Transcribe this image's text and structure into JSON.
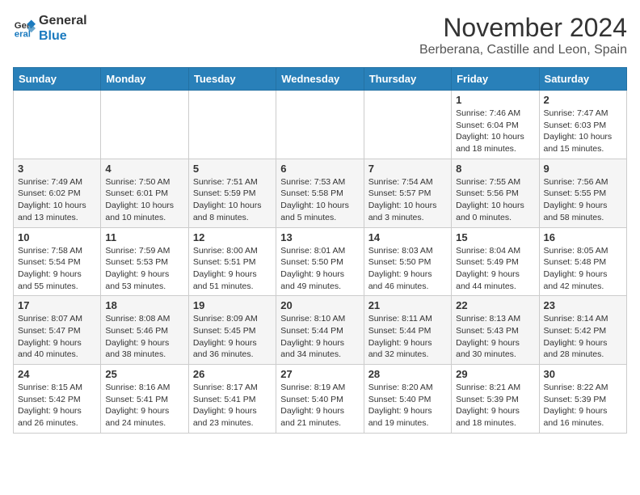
{
  "logo": {
    "line1": "General",
    "line2": "Blue"
  },
  "title": "November 2024",
  "location": "Berberana, Castille and Leon, Spain",
  "days_of_week": [
    "Sunday",
    "Monday",
    "Tuesday",
    "Wednesday",
    "Thursday",
    "Friday",
    "Saturday"
  ],
  "weeks": [
    [
      {
        "day": "",
        "info": ""
      },
      {
        "day": "",
        "info": ""
      },
      {
        "day": "",
        "info": ""
      },
      {
        "day": "",
        "info": ""
      },
      {
        "day": "",
        "info": ""
      },
      {
        "day": "1",
        "info": "Sunrise: 7:46 AM\nSunset: 6:04 PM\nDaylight: 10 hours and 18 minutes."
      },
      {
        "day": "2",
        "info": "Sunrise: 7:47 AM\nSunset: 6:03 PM\nDaylight: 10 hours and 15 minutes."
      }
    ],
    [
      {
        "day": "3",
        "info": "Sunrise: 7:49 AM\nSunset: 6:02 PM\nDaylight: 10 hours and 13 minutes."
      },
      {
        "day": "4",
        "info": "Sunrise: 7:50 AM\nSunset: 6:01 PM\nDaylight: 10 hours and 10 minutes."
      },
      {
        "day": "5",
        "info": "Sunrise: 7:51 AM\nSunset: 5:59 PM\nDaylight: 10 hours and 8 minutes."
      },
      {
        "day": "6",
        "info": "Sunrise: 7:53 AM\nSunset: 5:58 PM\nDaylight: 10 hours and 5 minutes."
      },
      {
        "day": "7",
        "info": "Sunrise: 7:54 AM\nSunset: 5:57 PM\nDaylight: 10 hours and 3 minutes."
      },
      {
        "day": "8",
        "info": "Sunrise: 7:55 AM\nSunset: 5:56 PM\nDaylight: 10 hours and 0 minutes."
      },
      {
        "day": "9",
        "info": "Sunrise: 7:56 AM\nSunset: 5:55 PM\nDaylight: 9 hours and 58 minutes."
      }
    ],
    [
      {
        "day": "10",
        "info": "Sunrise: 7:58 AM\nSunset: 5:54 PM\nDaylight: 9 hours and 55 minutes."
      },
      {
        "day": "11",
        "info": "Sunrise: 7:59 AM\nSunset: 5:53 PM\nDaylight: 9 hours and 53 minutes."
      },
      {
        "day": "12",
        "info": "Sunrise: 8:00 AM\nSunset: 5:51 PM\nDaylight: 9 hours and 51 minutes."
      },
      {
        "day": "13",
        "info": "Sunrise: 8:01 AM\nSunset: 5:50 PM\nDaylight: 9 hours and 49 minutes."
      },
      {
        "day": "14",
        "info": "Sunrise: 8:03 AM\nSunset: 5:50 PM\nDaylight: 9 hours and 46 minutes."
      },
      {
        "day": "15",
        "info": "Sunrise: 8:04 AM\nSunset: 5:49 PM\nDaylight: 9 hours and 44 minutes."
      },
      {
        "day": "16",
        "info": "Sunrise: 8:05 AM\nSunset: 5:48 PM\nDaylight: 9 hours and 42 minutes."
      }
    ],
    [
      {
        "day": "17",
        "info": "Sunrise: 8:07 AM\nSunset: 5:47 PM\nDaylight: 9 hours and 40 minutes."
      },
      {
        "day": "18",
        "info": "Sunrise: 8:08 AM\nSunset: 5:46 PM\nDaylight: 9 hours and 38 minutes."
      },
      {
        "day": "19",
        "info": "Sunrise: 8:09 AM\nSunset: 5:45 PM\nDaylight: 9 hours and 36 minutes."
      },
      {
        "day": "20",
        "info": "Sunrise: 8:10 AM\nSunset: 5:44 PM\nDaylight: 9 hours and 34 minutes."
      },
      {
        "day": "21",
        "info": "Sunrise: 8:11 AM\nSunset: 5:44 PM\nDaylight: 9 hours and 32 minutes."
      },
      {
        "day": "22",
        "info": "Sunrise: 8:13 AM\nSunset: 5:43 PM\nDaylight: 9 hours and 30 minutes."
      },
      {
        "day": "23",
        "info": "Sunrise: 8:14 AM\nSunset: 5:42 PM\nDaylight: 9 hours and 28 minutes."
      }
    ],
    [
      {
        "day": "24",
        "info": "Sunrise: 8:15 AM\nSunset: 5:42 PM\nDaylight: 9 hours and 26 minutes."
      },
      {
        "day": "25",
        "info": "Sunrise: 8:16 AM\nSunset: 5:41 PM\nDaylight: 9 hours and 24 minutes."
      },
      {
        "day": "26",
        "info": "Sunrise: 8:17 AM\nSunset: 5:41 PM\nDaylight: 9 hours and 23 minutes."
      },
      {
        "day": "27",
        "info": "Sunrise: 8:19 AM\nSunset: 5:40 PM\nDaylight: 9 hours and 21 minutes."
      },
      {
        "day": "28",
        "info": "Sunrise: 8:20 AM\nSunset: 5:40 PM\nDaylight: 9 hours and 19 minutes."
      },
      {
        "day": "29",
        "info": "Sunrise: 8:21 AM\nSunset: 5:39 PM\nDaylight: 9 hours and 18 minutes."
      },
      {
        "day": "30",
        "info": "Sunrise: 8:22 AM\nSunset: 5:39 PM\nDaylight: 9 hours and 16 minutes."
      }
    ]
  ]
}
